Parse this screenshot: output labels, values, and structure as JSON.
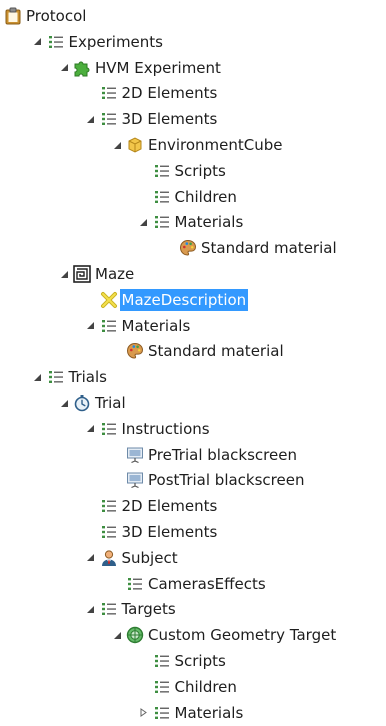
{
  "tree": {
    "nodes": [
      {
        "label": "Protocol",
        "icon": "clipboard-icon",
        "expander": "none",
        "depth": 0
      },
      {
        "label": "Experiments",
        "icon": "list-icon",
        "expander": "expanded",
        "depth": 1
      },
      {
        "label": "HVM Experiment",
        "icon": "puzzle-icon",
        "expander": "expanded",
        "depth": 2
      },
      {
        "label": "2D Elements",
        "icon": "list-icon",
        "expander": "none",
        "depth": 3
      },
      {
        "label": "3D Elements",
        "icon": "list-icon",
        "expander": "expanded",
        "depth": 3
      },
      {
        "label": "EnvironmentCube",
        "icon": "cube-icon",
        "expander": "expanded",
        "depth": 4
      },
      {
        "label": "Scripts",
        "icon": "list-icon",
        "expander": "none",
        "depth": 5
      },
      {
        "label": "Children",
        "icon": "list-icon",
        "expander": "none",
        "depth": 5
      },
      {
        "label": "Materials",
        "icon": "list-icon",
        "expander": "expanded",
        "depth": 5
      },
      {
        "label": "Standard material",
        "icon": "palette-icon",
        "expander": "none",
        "depth": 6
      },
      {
        "label": "Maze",
        "icon": "maze-icon",
        "expander": "expanded",
        "depth": 2
      },
      {
        "label": "MazeDescription",
        "icon": "cross-icon",
        "expander": "none",
        "depth": 3,
        "selected": true
      },
      {
        "label": "Materials",
        "icon": "list-icon",
        "expander": "expanded",
        "depth": 3
      },
      {
        "label": "Standard material",
        "icon": "palette-icon",
        "expander": "none",
        "depth": 4
      },
      {
        "label": "Trials",
        "icon": "list-icon",
        "expander": "expanded",
        "depth": 1
      },
      {
        "label": "Trial",
        "icon": "stopwatch-icon",
        "expander": "expanded",
        "depth": 2
      },
      {
        "label": "Instructions",
        "icon": "list-icon",
        "expander": "expanded",
        "depth": 3
      },
      {
        "label": "PreTrial blackscreen",
        "icon": "slide-icon",
        "expander": "none",
        "depth": 4
      },
      {
        "label": "PostTrial blackscreen",
        "icon": "slide-icon",
        "expander": "none",
        "depth": 4
      },
      {
        "label": "2D Elements",
        "icon": "list-icon",
        "expander": "none",
        "depth": 3
      },
      {
        "label": "3D Elements",
        "icon": "list-icon",
        "expander": "none",
        "depth": 3
      },
      {
        "label": "Subject",
        "icon": "person-icon",
        "expander": "expanded",
        "depth": 3
      },
      {
        "label": "CamerasEffects",
        "icon": "list-icon",
        "expander": "none",
        "depth": 4
      },
      {
        "label": "Targets",
        "icon": "list-icon",
        "expander": "expanded",
        "depth": 3
      },
      {
        "label": "Custom Geometry Target",
        "icon": "target-icon",
        "expander": "expanded",
        "depth": 4
      },
      {
        "label": "Scripts",
        "icon": "list-icon",
        "expander": "none",
        "depth": 5
      },
      {
        "label": "Children",
        "icon": "list-icon",
        "expander": "none",
        "depth": 5
      },
      {
        "label": "Materials",
        "icon": "list-icon",
        "expander": "collapsed",
        "depth": 5
      }
    ]
  },
  "colors": {
    "selection": "#3399ff",
    "selection_text": "#ffffff",
    "text": "#1e1e1e",
    "list_icon": "#3e8e41",
    "expander": "#444444"
  }
}
